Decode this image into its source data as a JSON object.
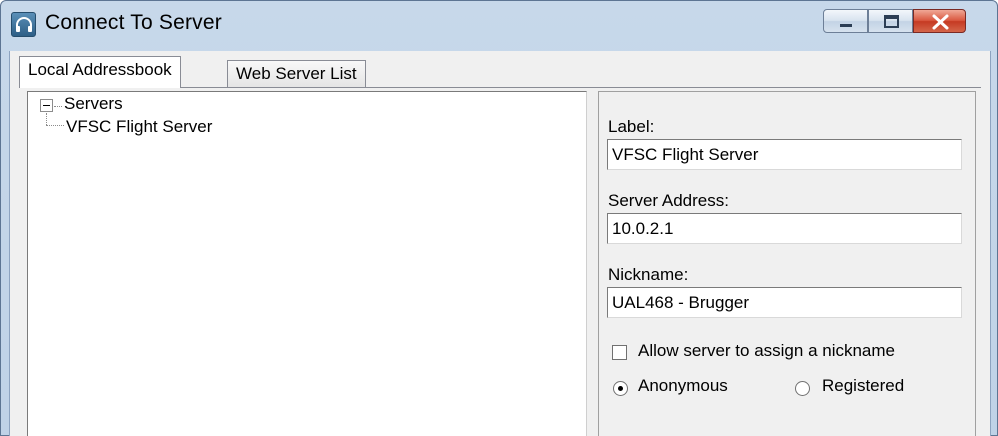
{
  "window": {
    "title": "Connect To Server",
    "app_icon": "headset-icon",
    "controls": {
      "minimize": "minimize-icon",
      "maximize": "maximize-icon",
      "close": "close-icon"
    }
  },
  "tabs": [
    {
      "label": "Local Addressbook",
      "active": true
    },
    {
      "label": "Web Server List",
      "active": false
    }
  ],
  "tree": {
    "root_label": "Servers",
    "expanded": true,
    "children": [
      {
        "label": "VFSC Flight Server"
      }
    ]
  },
  "form": {
    "label": {
      "caption": "Label:",
      "value": "VFSC Flight Server"
    },
    "server_address": {
      "caption": "Server Address:",
      "value": "10.0.2.1"
    },
    "nickname": {
      "caption": "Nickname:",
      "value": "UAL468 - Brugger"
    },
    "allow_assign": {
      "label": "Allow server to assign a nickname",
      "checked": false
    },
    "login_type": {
      "options": [
        {
          "label": "Anonymous",
          "selected": true
        },
        {
          "label": "Registered",
          "selected": false
        }
      ]
    }
  },
  "colors": {
    "titlebar": "#c7d8ea",
    "close_button": "#c53a22",
    "panel": "#f0f0f0"
  }
}
